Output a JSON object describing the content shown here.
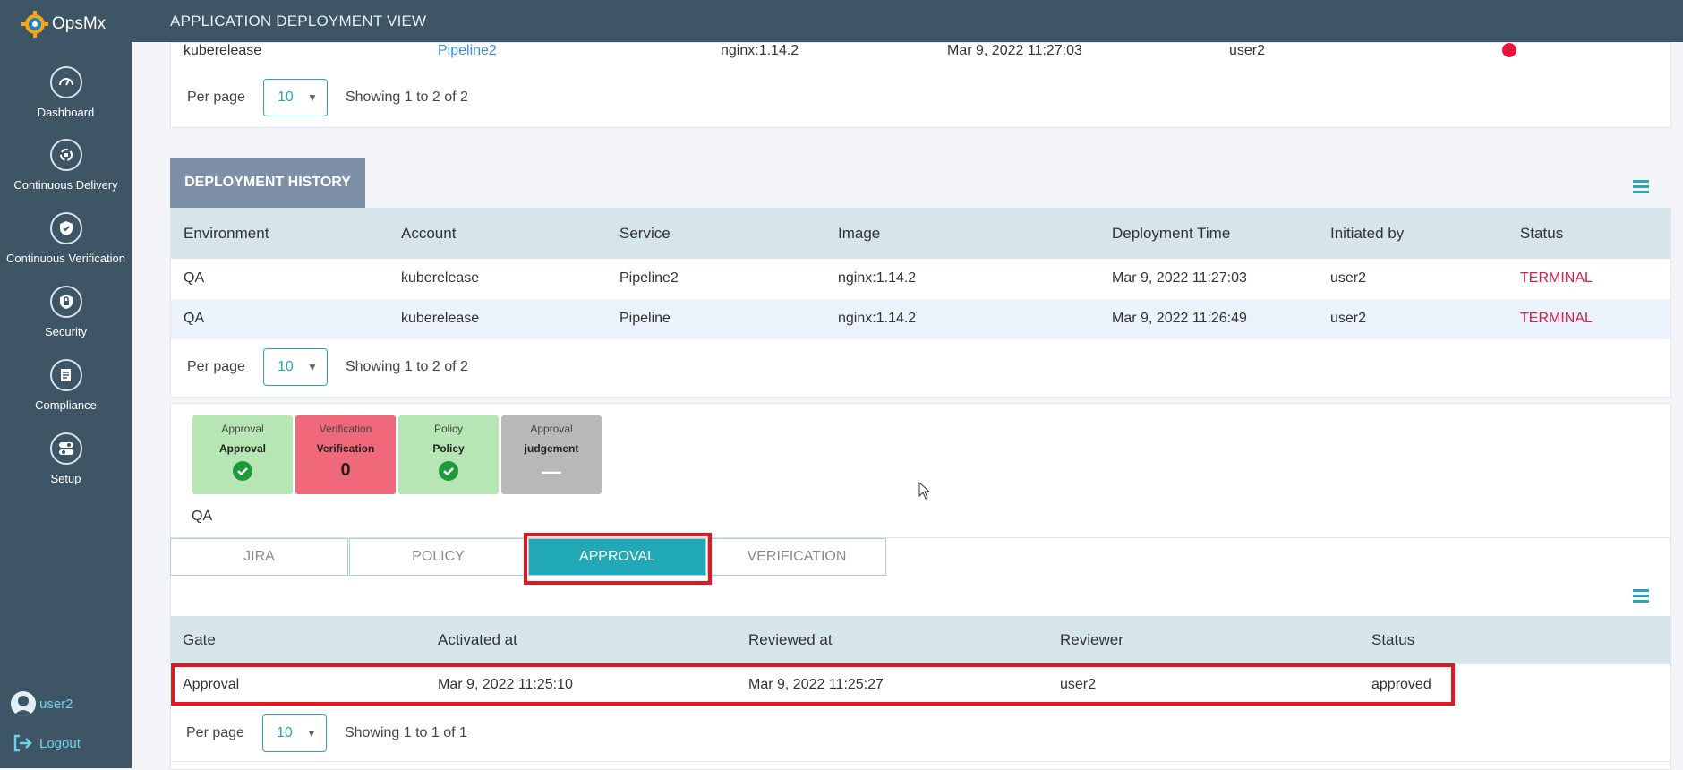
{
  "app": {
    "name": "OpsMx",
    "header_title": "APPLICATION DEPLOYMENT VIEW"
  },
  "sidebar": {
    "items": [
      {
        "label": "Dashboard",
        "icon": "speedometer-icon"
      },
      {
        "label": "Continuous Delivery",
        "icon": "cycle-icon"
      },
      {
        "label": "Continuous Verification",
        "icon": "shield-check-icon"
      },
      {
        "label": "Security",
        "icon": "lock-icon"
      },
      {
        "label": "Compliance",
        "icon": "document-icon"
      },
      {
        "label": "Setup",
        "icon": "toggle-icon"
      }
    ],
    "user": "user2",
    "logout": "Logout"
  },
  "top_panel": {
    "row": {
      "account": "kuberelease",
      "service": "Pipeline2",
      "image": "nginx:1.14.2",
      "time": "Mar 9, 2022 11:27:03",
      "user": "user2"
    },
    "per_page_label": "Per page",
    "per_page_value": "10",
    "showing": "Showing 1 to 2 of 2"
  },
  "history": {
    "tab_label": "DEPLOYMENT HISTORY",
    "columns": [
      "Environment",
      "Account",
      "Service",
      "Image",
      "Deployment Time",
      "Initiated by",
      "Status"
    ],
    "rows": [
      [
        "QA",
        "kuberelease",
        "Pipeline2",
        "nginx:1.14.2",
        "Mar 9, 2022 11:27:03",
        "user2",
        "TERMINAL"
      ],
      [
        "QA",
        "kuberelease",
        "Pipeline",
        "nginx:1.14.2",
        "Mar 9, 2022 11:26:49",
        "user2",
        "TERMINAL"
      ]
    ],
    "per_page_label": "Per page",
    "per_page_value": "10",
    "showing": "Showing 1 to 2 of 2"
  },
  "stages": [
    {
      "type": "Approval",
      "name": "Approval",
      "status": "check",
      "color": "#b5e6b3"
    },
    {
      "type": "Verification",
      "name": "Verification",
      "status": "0",
      "color": "#f0697a"
    },
    {
      "type": "Policy",
      "name": "Policy",
      "status": "check",
      "color": "#b5e6b3"
    },
    {
      "type": "Approval",
      "name": "judgement",
      "status": "—",
      "color": "#b8b8b8"
    }
  ],
  "environment_label": "QA",
  "tabs": [
    "JIRA",
    "POLICY",
    "APPROVAL",
    "VERIFICATION"
  ],
  "active_tab": "APPROVAL",
  "approval_table": {
    "columns": [
      "Gate",
      "Activated at",
      "Reviewed at",
      "Reviewer",
      "Status"
    ],
    "rows": [
      [
        "Approval",
        "Mar 9, 2022 11:25:10",
        "Mar 9, 2022 11:25:27",
        "user2",
        "approved"
      ]
    ],
    "per_page_label": "Per page",
    "per_page_value": "10",
    "showing": "Showing 1 to 1 of 1"
  },
  "colors": {
    "sidebar": "#3e5566",
    "accent": "#2aa5b8",
    "terminal": "#d3204b",
    "highlight": "#e8141f"
  }
}
